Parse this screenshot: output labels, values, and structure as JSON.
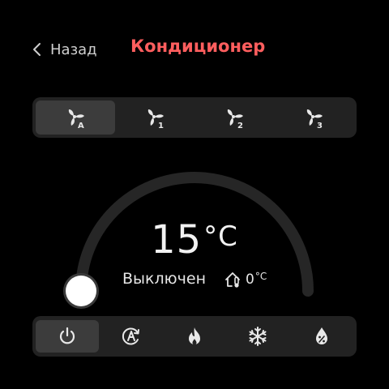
{
  "header": {
    "back_label": "Назад",
    "title": "Кондиционер"
  },
  "fan_modes": [
    {
      "label": "A",
      "icon": "fan-auto-icon",
      "active": true
    },
    {
      "label": "1",
      "icon": "fan-speed-1-icon",
      "active": false
    },
    {
      "label": "2",
      "icon": "fan-speed-2-icon",
      "active": false
    },
    {
      "label": "3",
      "icon": "fan-speed-3-icon",
      "active": false
    }
  ],
  "thermostat": {
    "set_temperature": "15",
    "unit": "°C",
    "status": "Выключен",
    "room_temperature": "0",
    "room_unit": "°C",
    "dial_level": 0
  },
  "modes": [
    {
      "icon": "power-icon",
      "active": true
    },
    {
      "icon": "auto-mode-icon",
      "active": false
    },
    {
      "icon": "heat-flame-icon",
      "active": false
    },
    {
      "icon": "cool-snowflake-icon",
      "active": false
    },
    {
      "icon": "dry-humidity-icon",
      "active": false
    }
  ],
  "colors": {
    "title": "#ff5e5e",
    "panel": "#222222",
    "active": "#3c3c3c",
    "arc": "#262626"
  }
}
